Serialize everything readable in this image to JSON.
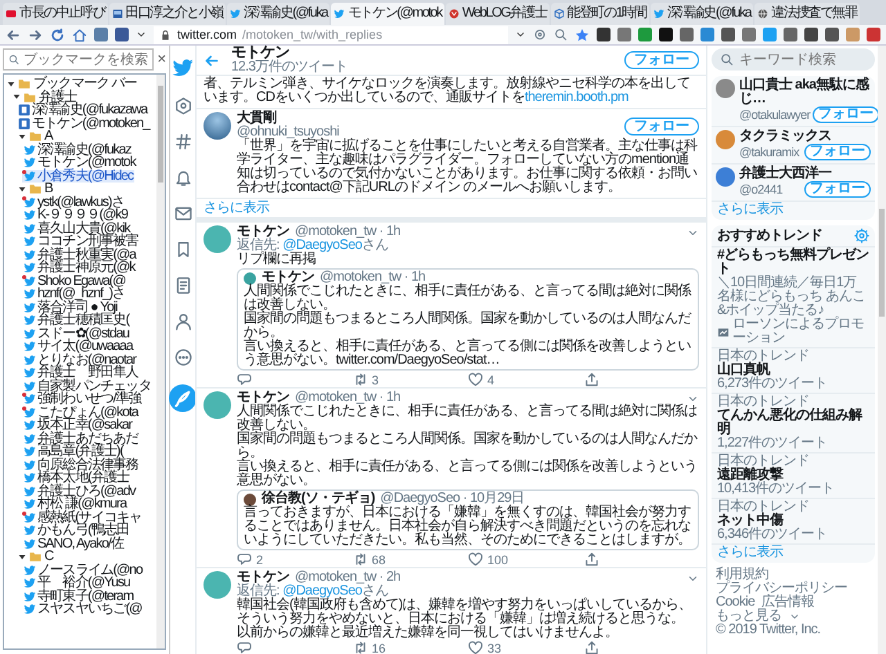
{
  "browser": {
    "tabs": [
      {
        "kind": "yahoo",
        "title": "市長の中止呼び",
        "selected": false
      },
      {
        "kind": "news",
        "title": "田口淳之介と小嶺",
        "selected": false
      },
      {
        "kind": "twitter",
        "title": "深澤諭史(@fuka",
        "selected": false
      },
      {
        "kind": "twitter",
        "title": "モトケン(@motok",
        "selected": true
      },
      {
        "kind": "blog",
        "title": "WebLOG弁護士",
        "selected": false
      },
      {
        "kind": "cube",
        "title": "能登町の1時間",
        "selected": false
      },
      {
        "kind": "twitter",
        "title": "深澤諭史(@fuka",
        "selected": false
      },
      {
        "kind": "globe",
        "title": "違法捜査で無罪",
        "selected": false
      }
    ],
    "address": {
      "host": "twitter.com",
      "path": "/motoken_tw/with_replies"
    }
  },
  "bookmarks": {
    "close": "×",
    "search": {
      "placeholder": "ブックマークを検索"
    },
    "tree": [
      {
        "kind": "folder",
        "label": "ブックマーク バー",
        "expanded": true,
        "children": [
          {
            "kind": "folder",
            "label": "弁護士",
            "expanded": true,
            "children": [
              {
                "kind": "square",
                "label": "深澤諭史(@fukazawa",
                "selected": false,
                "flagged": false
              },
              {
                "kind": "square",
                "label": "モトケン(@motoken_",
                "selected": false,
                "flagged": false
              },
              {
                "kind": "folder",
                "label": "A",
                "expanded": true,
                "children": [
                  {
                    "kind": "bird",
                    "label": "深澤諭史(@fukaz",
                    "selected": false,
                    "flagged": false
                  },
                  {
                    "kind": "bird",
                    "label": "モトケン(@motok",
                    "selected": false,
                    "flagged": false
                  },
                  {
                    "kind": "bird",
                    "label": "小倉秀夫(@Hidec",
                    "selected": true,
                    "flagged": true
                  }
                ]
              },
              {
                "kind": "folder",
                "label": "B",
                "expanded": true,
                "children": [
                  {
                    "kind": "bird",
                    "label": "ystk(@lawkus)さ",
                    "selected": false,
                    "flagged": true
                  },
                  {
                    "kind": "bird",
                    "label": "K-９９９９(@k9",
                    "selected": false,
                    "flagged": false
                  },
                  {
                    "kind": "bird",
                    "label": "喜久山大貴(@kik",
                    "selected": false,
                    "flagged": false
                  },
                  {
                    "kind": "bird",
                    "label": "ココチン刑事被害",
                    "selected": false,
                    "flagged": false
                  },
                  {
                    "kind": "bird",
                    "label": "弁護士秋重実(@a",
                    "selected": false,
                    "flagged": false
                  },
                  {
                    "kind": "bird",
                    "label": "弁護士神原元(@k",
                    "selected": false,
                    "flagged": false
                  },
                  {
                    "kind": "bird",
                    "label": "Shoko Egawa(@",
                    "selected": false,
                    "flagged": true
                  },
                  {
                    "kind": "bird",
                    "label": "hznf(@_hznf_)さ",
                    "selected": false,
                    "flagged": false
                  },
                  {
                    "kind": "bird",
                    "label": "落合洋司 ● Yoji",
                    "selected": false,
                    "flagged": false
                  },
                  {
                    "kind": "bird",
                    "label": "弁護士穂積匡史(",
                    "selected": false,
                    "flagged": false
                  },
                  {
                    "kind": "bird",
                    "label": "スドー✿(@stdau",
                    "selected": false,
                    "flagged": false
                  },
                  {
                    "kind": "bird",
                    "label": "サイ太(@uwaaaa",
                    "selected": false,
                    "flagged": false
                  },
                  {
                    "kind": "bird",
                    "label": "とりなお(@naotar",
                    "selected": false,
                    "flagged": false
                  },
                  {
                    "kind": "bird",
                    "label": "弁護士　野田隼人",
                    "selected": false,
                    "flagged": false
                  },
                  {
                    "kind": "bird",
                    "label": "自家製パンチェッタ",
                    "selected": false,
                    "flagged": false
                  },
                  {
                    "kind": "bird",
                    "label": "強制わいせつ/準強",
                    "selected": false,
                    "flagged": true
                  },
                  {
                    "kind": "bird",
                    "label": "こたぴょん(@kota",
                    "selected": false,
                    "flagged": true
                  },
                  {
                    "kind": "bird",
                    "label": "坂本正幸(@sakar",
                    "selected": false,
                    "flagged": false
                  },
                  {
                    "kind": "bird",
                    "label": "弁護士あだちあだ",
                    "selected": false,
                    "flagged": false
                  },
                  {
                    "kind": "bird",
                    "label": "高島章(弁護士)(",
                    "selected": false,
                    "flagged": false
                  },
                  {
                    "kind": "bird",
                    "label": "向原総合法律事務",
                    "selected": false,
                    "flagged": false
                  },
                  {
                    "kind": "bird",
                    "label": "橋本太地(弁護士",
                    "selected": false,
                    "flagged": false
                  },
                  {
                    "kind": "bird",
                    "label": "弁護士ひろ(@adv",
                    "selected": false,
                    "flagged": false
                  },
                  {
                    "kind": "bird",
                    "label": "村松 謙(@kmura",
                    "selected": false,
                    "flagged": false
                  },
                  {
                    "kind": "bird",
                    "label": "感熱紙(サイコキャ",
                    "selected": false,
                    "flagged": true
                  },
                  {
                    "kind": "bird",
                    "label": "かもん弓(鴨志田",
                    "selected": false,
                    "flagged": false
                  },
                  {
                    "kind": "bird",
                    "label": "SANO, Ayako/佐",
                    "selected": false,
                    "flagged": false
                  }
                ]
              },
              {
                "kind": "folder",
                "label": "C",
                "expanded": true,
                "children": [
                  {
                    "kind": "bird",
                    "label": "ノースライム(@no",
                    "selected": false,
                    "flagged": false
                  },
                  {
                    "kind": "bird",
                    "label": "平　裕介(@Yusu",
                    "selected": false,
                    "flagged": false
                  },
                  {
                    "kind": "bird",
                    "label": "寺町東子(@teram",
                    "selected": false,
                    "flagged": false
                  },
                  {
                    "kind": "bird",
                    "label": "スヤスヤいちご(@",
                    "selected": false,
                    "flagged": false
                  }
                ]
              }
            ]
          }
        ]
      }
    ]
  },
  "timeline": {
    "header": {
      "name": "モトケン",
      "count": "12.3万件のツイート",
      "follow": "フォロー"
    },
    "bio_fragment": {
      "text": "者、テルミン弾き、サイケなロックを演奏します。放射線やニセ科学の本を出しています。CDをいくつか出しているので、通販サイトを",
      "link": "theremin.booth.pm"
    },
    "user_card": {
      "name": "大貫剛",
      "handle": "@ohnuki_tsuyoshi",
      "follow": "フォロー",
      "bio": "「世界」を宇宙に拡げることを仕事にしたいと考える自営業者。主な仕事は科学ライター、主な趣味はパラグライダー。フォローしていない方のmention通知は切っているので気付かないことがあります。お仕事に関する依頼・お問い合わせはcontact@下記URLのドメイン のメールへお願いします。"
    },
    "more": "さらに表示",
    "tweets": [
      {
        "name": "モトケン",
        "meta": "@motoken_tw · 1h",
        "reply_label": "返信先:",
        "reply_to": "@DaegyoSeo",
        "reply_suffix": "さん",
        "text": [
          "リプ欄に再掲"
        ],
        "quote": {
          "name": "モトケン",
          "meta": "@motoken_tw · 1h",
          "text": [
            "人間関係でこじれたときに、相手に責任がある、と言ってる間は絶対に関係は改善しない。",
            "国家間の問題もつまるところ人間関係。国家を動かしているのは人間なんだから。",
            "言い換えると、相手に責任がある、と言ってる側には関係を改善しようという意思がない。twitter.com/DaegyoSeo/stat…"
          ]
        },
        "actions": {
          "retweet": "3",
          "like": "4"
        }
      },
      {
        "name": "モトケン",
        "meta": "@motoken_tw · 1h",
        "text": [
          "人間関係でこじれたときに、相手に責任がある、と言ってる間は絶対に関係は改善しない。",
          "国家間の問題もつまるところ人間関係。国家を動かしているのは人間なんだから。",
          "言い換えると、相手に責任がある、と言ってる側には関係を改善しようという意思がない。"
        ],
        "quote": {
          "name": "徐台教(ソ・テギョ)",
          "meta": "@DaegyoSeo · 10月29日",
          "text": [
            "言っておきますが、日本における「嫌韓」を無くすのは、韓国社会が努力することではありません。日本社会が自ら解決すべき問題だというのを忘れないようにしていただきたい。私も当然、そのためにできることはしますが。"
          ]
        },
        "actions": {
          "reply": "2",
          "retweet": "68",
          "like": "100"
        }
      },
      {
        "name": "モトケン",
        "meta": "@motoken_tw · 2h",
        "reply_label": "返信先:",
        "reply_to": "@DaegyoSeo",
        "reply_suffix": "さん",
        "text": [
          "韓国社会(韓国政府も含めて)は、嫌韓を増やす努力をいっぱいしているから、そういう努力をやめないと、日本における「嫌韓」は増え続けると思うな。",
          "以前からの嫌韓と最近増えた嫌韓を同一視してはいけませんよ。"
        ],
        "actions": {
          "retweet": "16",
          "like": "33"
        }
      }
    ]
  },
  "sidebar": {
    "search": {
      "placeholder": "キーワード検索"
    },
    "who_to_follow": [
      {
        "name": "山口貴士 aka無駄に感じ…",
        "handle": "@otakulawyer",
        "follow": "フォロー",
        "color": "#8a8a8a"
      },
      {
        "name": "タクラミックス",
        "handle": "@takuramix",
        "follow": "フォロー",
        "color": "#d88a3a"
      },
      {
        "name": "弁護士大西洋一",
        "handle": "@o2441",
        "follow": "フォロー",
        "color": "#3d7fd6"
      }
    ],
    "follow_more": "さらに表示",
    "trends_title": "おすすめトレンド",
    "trends": [
      {
        "kind": "promoted",
        "name": "#どらもっち無料プレゼント",
        "description": "＼10日間連続／毎日1万名様にどらもっち あんこ&ホイップ当たる♪",
        "promoter": "ローソンによるプロモーション"
      },
      {
        "kind": "trend",
        "context": "日本のトレンド",
        "name": "山口真帆",
        "count": "6,273件のツイート"
      },
      {
        "kind": "trend",
        "context": "日本のトレンド",
        "name": "てんかん悪化の仕組み解明",
        "count": "1,227件のツイート"
      },
      {
        "kind": "trend",
        "context": "日本のトレンド",
        "name": "遠距離攻撃",
        "count": "10,413件のツイート"
      },
      {
        "kind": "trend",
        "context": "日本のトレンド",
        "name": "ネット中傷",
        "count": "6,346件のツイート"
      }
    ],
    "trends_more": "さらに表示",
    "footer": [
      "利用規約",
      "プライバシーポリシー",
      "Cookie",
      "広告情報"
    ],
    "footer_more": "もっと見る",
    "copyright": "© 2019 Twitter, Inc."
  }
}
